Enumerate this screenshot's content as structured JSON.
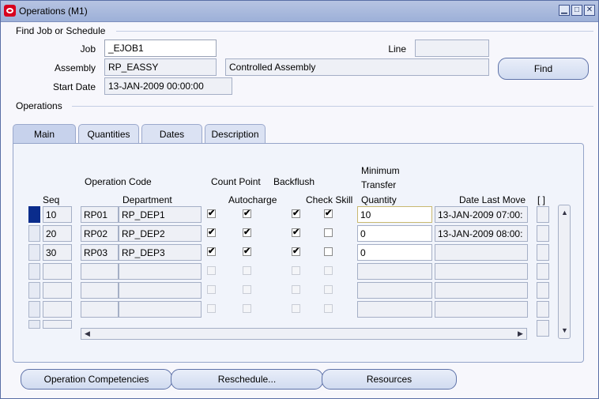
{
  "window": {
    "title": "Operations (M1)"
  },
  "find_section": {
    "title": "Find Job or Schedule",
    "job_label": "Job",
    "job_value": "_EJOB1",
    "line_label": "Line",
    "line_value": "",
    "assembly_label": "Assembly",
    "assembly_value": "RP_EASSY",
    "assembly_desc": "Controlled Assembly",
    "start_date_label": "Start Date",
    "start_date_value": "13-JAN-2009 00:00:00",
    "find_button": "Find"
  },
  "operations_section": {
    "title": "Operations"
  },
  "tabs": [
    {
      "label": "Main",
      "active": true
    },
    {
      "label": "Quantities",
      "active": false
    },
    {
      "label": "Dates",
      "active": false
    },
    {
      "label": "Description",
      "active": false
    }
  ],
  "table": {
    "headers": {
      "seq": "Seq",
      "operation_code": "Operation Code",
      "department": "Department",
      "count_point": "Count Point",
      "autocharge": "Autocharge",
      "backflush": "Backflush",
      "check_skill": "Check Skill",
      "min_transfer_1": "Minimum",
      "min_transfer_2": "Transfer",
      "min_transfer_3": "Quantity",
      "date_last_move": "Date Last Move",
      "extra": "[ ]"
    },
    "rows": [
      {
        "seq": "10",
        "code": "RP01",
        "dept": "RP_DEP1",
        "count_point": true,
        "autocharge": true,
        "backflush": true,
        "check_skill": true,
        "min_qty": "10",
        "last_move": "13-JAN-2009 07:00:"
      },
      {
        "seq": "20",
        "code": "RP02",
        "dept": "RP_DEP2",
        "count_point": true,
        "autocharge": true,
        "backflush": true,
        "check_skill": false,
        "min_qty": "0",
        "last_move": "13-JAN-2009 08:00:"
      },
      {
        "seq": "30",
        "code": "RP03",
        "dept": "RP_DEP3",
        "count_point": true,
        "autocharge": true,
        "backflush": true,
        "check_skill": false,
        "min_qty": "0",
        "last_move": ""
      }
    ]
  },
  "bottom_buttons": {
    "competencies": "Operation Competencies",
    "reschedule": "Reschedule...",
    "resources": "Resources"
  },
  "glyphs": {
    "check": "✔",
    "minimize": "▁",
    "maximize": "□",
    "close": "✕",
    "up": "▲",
    "down": "▼",
    "left": "◀",
    "right": "▶"
  }
}
